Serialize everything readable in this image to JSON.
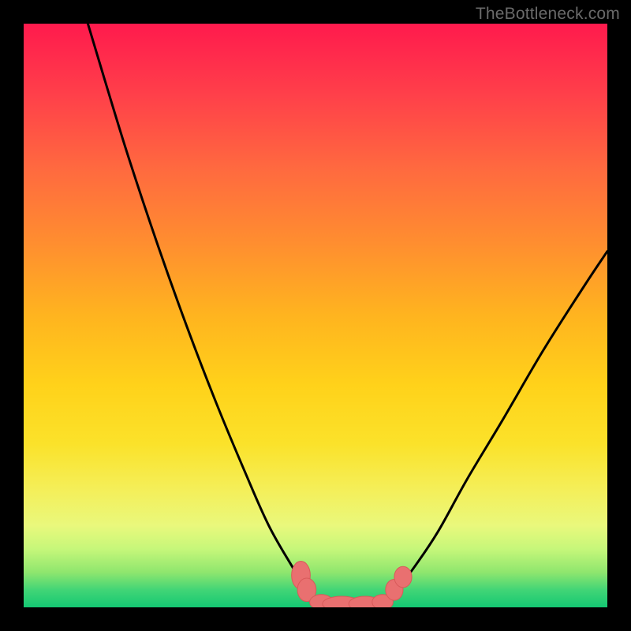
{
  "credit": "TheBottleneck.com",
  "colors": {
    "frame": "#000000",
    "curve_stroke": "#000000",
    "marker_fill": "#e97070",
    "marker_stroke": "#d85a5a"
  },
  "chart_data": {
    "type": "line",
    "title": "",
    "xlabel": "",
    "ylabel": "",
    "xlim": [
      0,
      100
    ],
    "ylim": [
      0,
      100
    ],
    "series": [
      {
        "name": "curve-left",
        "x": [
          11,
          14,
          18,
          23,
          28,
          33,
          38,
          42,
          46,
          48.5,
          50.5
        ],
        "y": [
          100,
          90,
          77,
          62,
          48,
          35,
          23,
          14,
          7,
          3,
          0.8
        ]
      },
      {
        "name": "curve-right",
        "x": [
          62,
          64,
          67,
          71,
          76,
          82,
          89,
          96,
          100
        ],
        "y": [
          0.8,
          3,
          7,
          13,
          22,
          32,
          44,
          55,
          61
        ]
      },
      {
        "name": "valley-flat",
        "x": [
          50.5,
          53,
          56,
          59,
          62
        ],
        "y": [
          0.8,
          0.5,
          0.5,
          0.5,
          0.8
        ]
      }
    ],
    "markers": {
      "name": "highlighted-points",
      "points": [
        {
          "x": 47.5,
          "y": 5.5,
          "rx": 1.6,
          "ry": 2.4
        },
        {
          "x": 48.5,
          "y": 3.0,
          "rx": 1.6,
          "ry": 2.0
        },
        {
          "x": 51.0,
          "y": 0.9,
          "rx": 2.0,
          "ry": 1.3
        },
        {
          "x": 54.5,
          "y": 0.6,
          "rx": 3.3,
          "ry": 1.3
        },
        {
          "x": 58.5,
          "y": 0.6,
          "rx": 2.8,
          "ry": 1.3
        },
        {
          "x": 61.5,
          "y": 0.9,
          "rx": 1.8,
          "ry": 1.3
        },
        {
          "x": 63.5,
          "y": 3.0,
          "rx": 1.5,
          "ry": 1.8
        },
        {
          "x": 65.0,
          "y": 5.2,
          "rx": 1.5,
          "ry": 1.8
        }
      ]
    }
  }
}
